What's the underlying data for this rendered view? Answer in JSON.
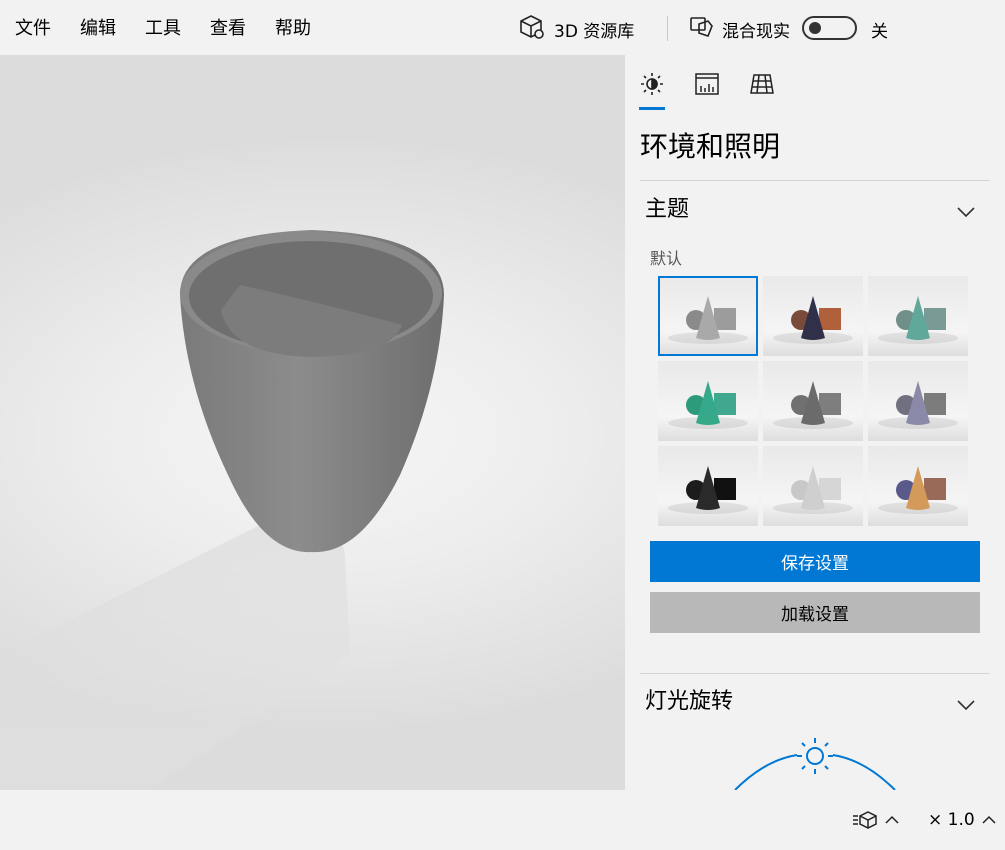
{
  "menu": {
    "items": [
      "文件",
      "编辑",
      "工具",
      "查看",
      "帮助"
    ],
    "library_label": "3D 资源库",
    "mixed_reality_label": "混合现实",
    "toggle_state": "关"
  },
  "panel": {
    "tabs": [
      "lighting-icon",
      "stats-icon",
      "grid-icon"
    ],
    "title": "环境和照明",
    "theme_section": "主题",
    "theme_selected": "默认",
    "save_label": "保存设置",
    "load_label": "加载设置",
    "light_section": "灯光旋转"
  },
  "themes": [
    {
      "sphere": "#8a8a8a",
      "cone": "#a9a9a9",
      "box": "#9c9c9c"
    },
    {
      "sphere": "#7a4a3a",
      "cone": "#303048",
      "box": "#b0603a"
    },
    {
      "sphere": "#6f8f88",
      "cone": "#5fa89a",
      "box": "#7a9a96"
    },
    {
      "sphere": "#2e9a7c",
      "cone": "#36a98a",
      "box": "#3fa88e"
    },
    {
      "sphere": "#707070",
      "cone": "#6b6b6b",
      "box": "#7e7e7e"
    },
    {
      "sphere": "#707080",
      "cone": "#8a8aa8",
      "box": "#7c7c7c"
    },
    {
      "sphere": "#1c1c1c",
      "cone": "#2a2a2a",
      "box": "#111111"
    },
    {
      "sphere": "#c8c8c8",
      "cone": "#cfcfcf",
      "box": "#d6d6d6"
    },
    {
      "sphere": "#5a5a8a",
      "cone": "#d49a5a",
      "box": "#9a6a58"
    }
  ],
  "status": {
    "zoom": "× 1.0"
  },
  "colors": {
    "accent": "#0078d4",
    "model": "#858585"
  }
}
